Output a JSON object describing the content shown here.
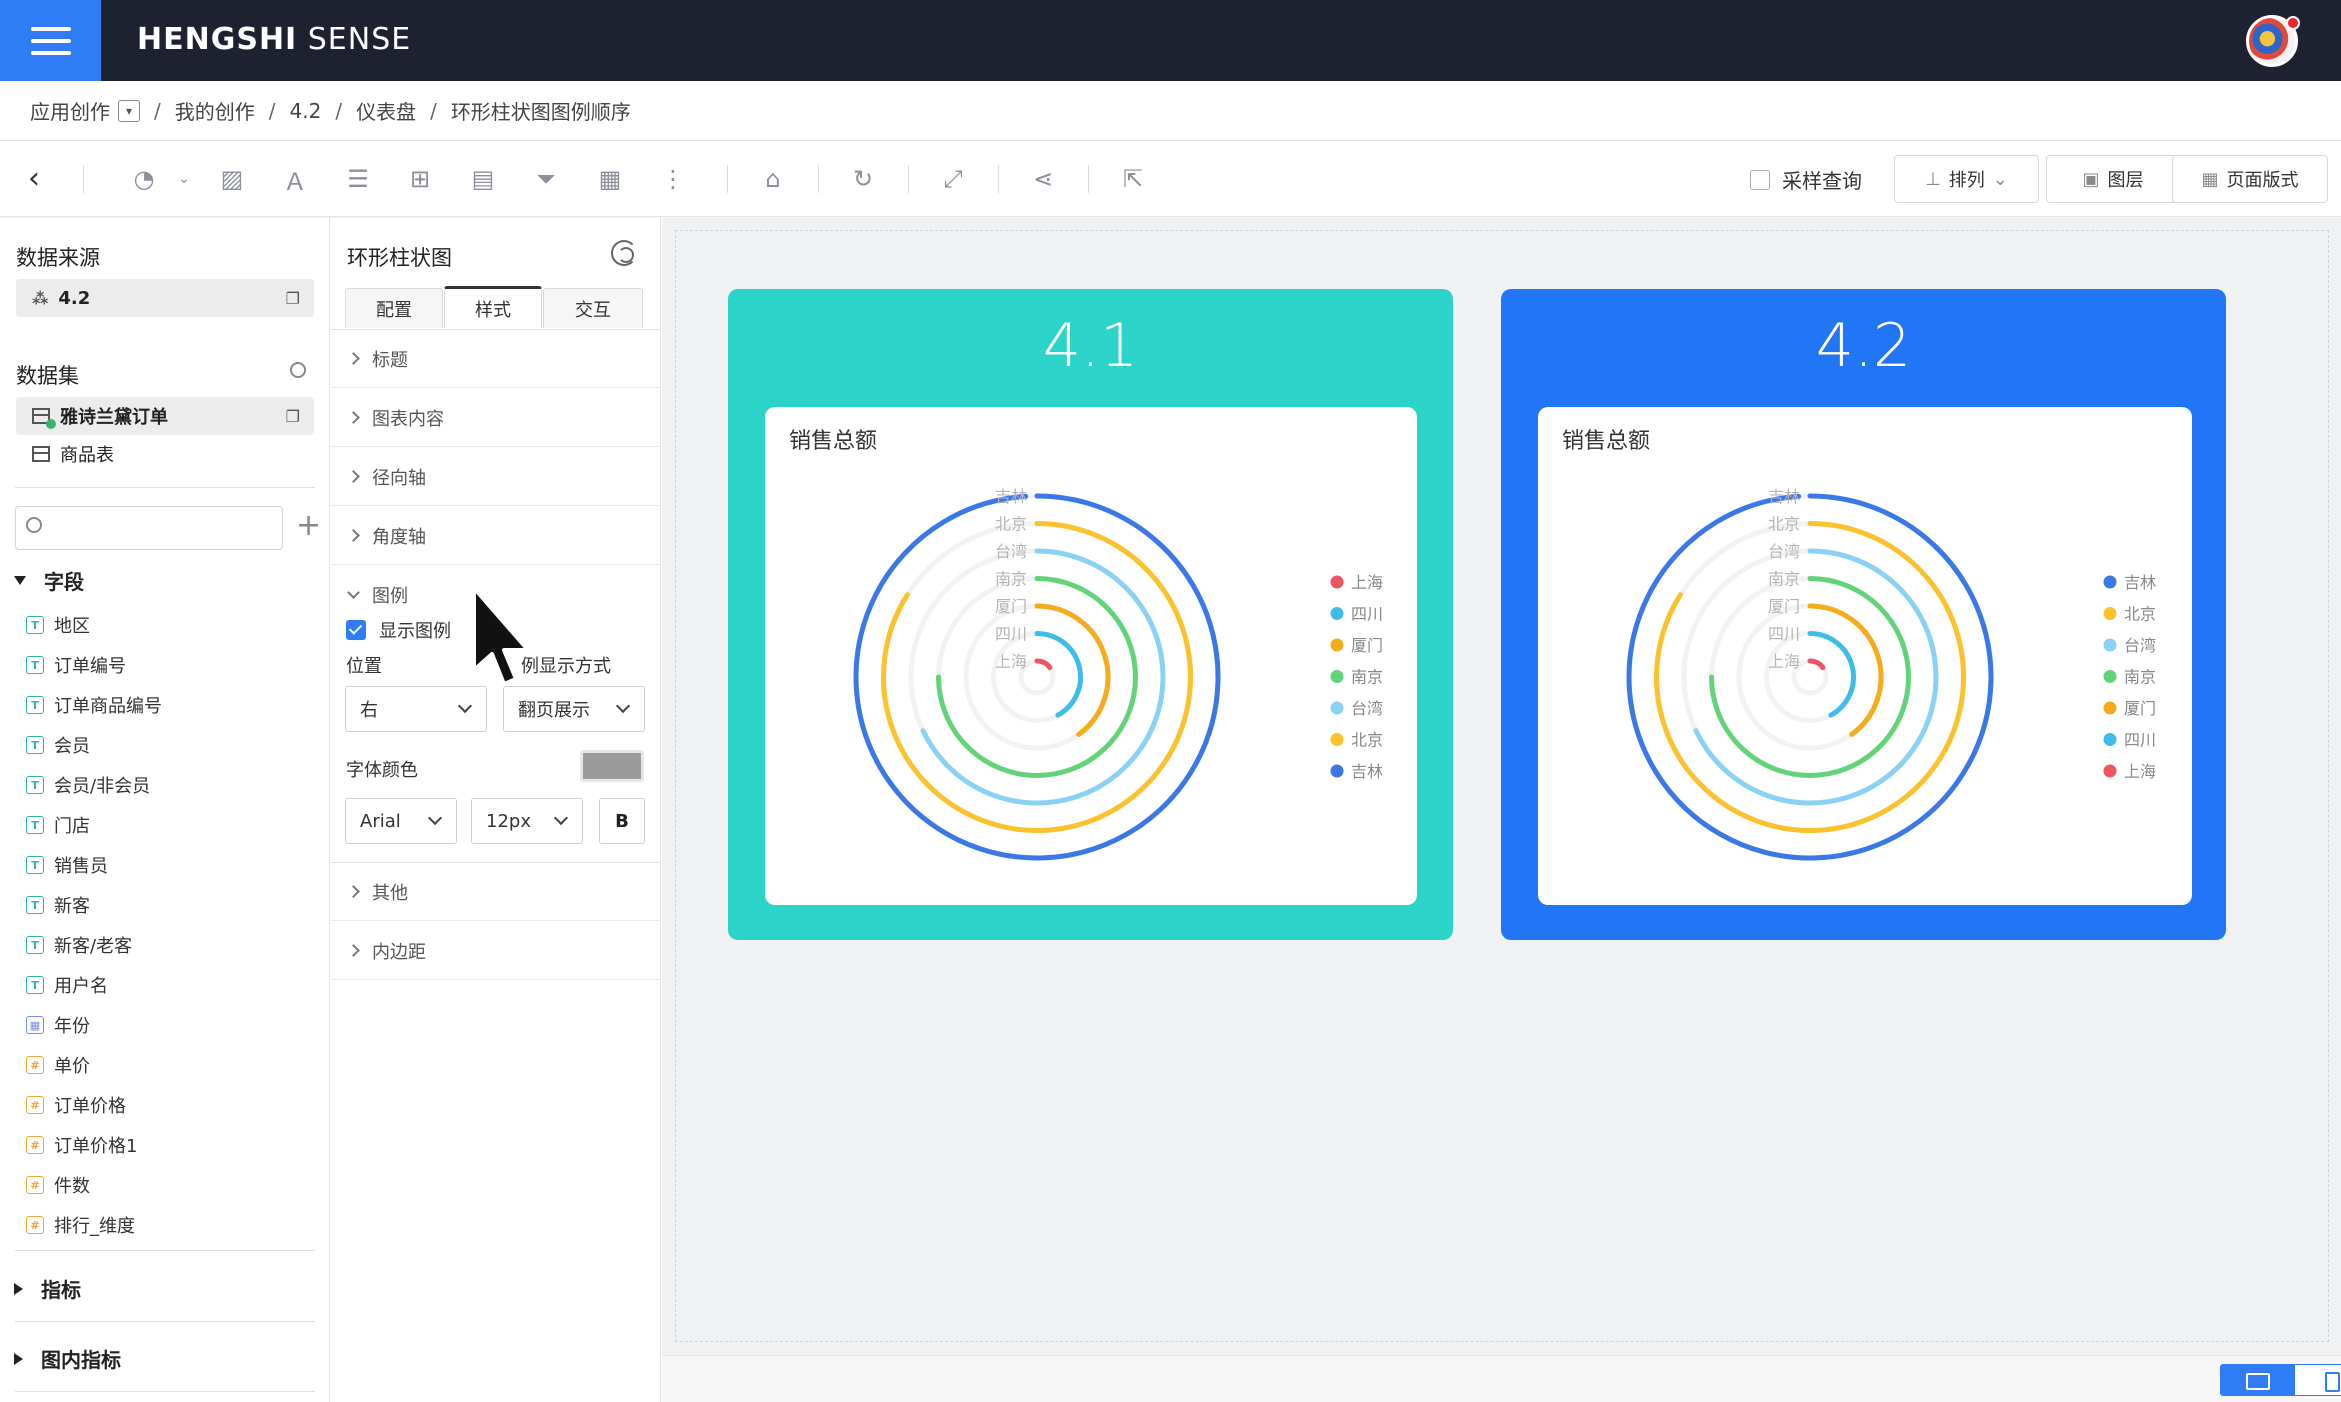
{
  "header": {
    "brand_bold": "HENGSHI",
    "brand_light": " SENSE"
  },
  "breadcrumb": [
    "应用创作",
    "我的创作",
    "4.2",
    "仪表盘",
    "环形柱状图图例顺序"
  ],
  "toolbar": {
    "sample_query_label": "采样查询",
    "arrange_label": "排列",
    "layers_label": "图层",
    "page_layout_label": "页面版式"
  },
  "left_panel": {
    "datasource_title": "数据来源",
    "datasource_item": "4.2",
    "dataset_title": "数据集",
    "datasets": [
      "雅诗兰黛订单",
      "商品表"
    ],
    "search_placeholder": "",
    "fields_title": "字段",
    "fields": [
      {
        "name": "地区",
        "type": "T"
      },
      {
        "name": "订单编号",
        "type": "T"
      },
      {
        "name": "订单商品编号",
        "type": "T"
      },
      {
        "name": "会员",
        "type": "T"
      },
      {
        "name": "会员/非会员",
        "type": "T"
      },
      {
        "name": "门店",
        "type": "T"
      },
      {
        "name": "销售员",
        "type": "T"
      },
      {
        "name": "新客",
        "type": "T"
      },
      {
        "name": "新客/老客",
        "type": "T"
      },
      {
        "name": "用户名",
        "type": "T"
      },
      {
        "name": "年份",
        "type": "date"
      },
      {
        "name": "单价",
        "type": "#"
      },
      {
        "name": "订单价格",
        "type": "#"
      },
      {
        "name": "订单价格1",
        "type": "#"
      },
      {
        "name": "件数",
        "type": "#"
      },
      {
        "name": "排行_维度",
        "type": "#"
      }
    ],
    "metrics_title": "指标",
    "inner_metrics_title": "图内指标"
  },
  "mid_panel": {
    "title": "环形柱状图",
    "tabs": [
      "配置",
      "样式",
      "交互"
    ],
    "active_tab": "样式",
    "sections": [
      "标题",
      "图表内容",
      "径向轴",
      "角度轴"
    ],
    "legend_section": "图例",
    "show_legend_label": "显示图例",
    "show_legend_checked": true,
    "position_label": "位置",
    "display_mode_label": "例显示方式",
    "position_value": "右",
    "display_mode_value": "翻页展示",
    "font_color_label": "字体颜色",
    "font_color": "#9b9b9b",
    "font_family_value": "Arial",
    "font_size_value": "12px",
    "bold_label": "B",
    "bottom_sections": [
      "其他",
      "内边距"
    ]
  },
  "chart_data": [
    {
      "type": "radial-bar",
      "card_title": "4.1",
      "card_color": "#2cd3c9",
      "title": "销售总额",
      "categories": [
        "吉林",
        "北京",
        "台湾",
        "南京",
        "厦门",
        "四川",
        "上海"
      ],
      "values": [
        0.99,
        0.84,
        0.68,
        0.75,
        0.4,
        0.42,
        0.15
      ],
      "colors": [
        "#3b78e7",
        "#fbc22e",
        "#89d1f5",
        "#63d37a",
        "#f5ab1b",
        "#3dbdeb",
        "#ee5563"
      ],
      "legend": [
        "上海",
        "四川",
        "厦门",
        "南京",
        "台湾",
        "北京",
        "吉林"
      ],
      "legend_colors": [
        "#ee5563",
        "#3dbdeb",
        "#f5ab1b",
        "#63d37a",
        "#89d1f5",
        "#fbc22e",
        "#3b78e7"
      ],
      "legend_position": "right"
    },
    {
      "type": "radial-bar",
      "card_title": "4.2",
      "card_color": "#2176f5",
      "title": "销售总额",
      "categories": [
        "吉林",
        "北京",
        "台湾",
        "南京",
        "厦门",
        "四川",
        "上海"
      ],
      "values": [
        0.99,
        0.84,
        0.68,
        0.75,
        0.4,
        0.42,
        0.15
      ],
      "colors": [
        "#3b78e7",
        "#fbc22e",
        "#89d1f5",
        "#63d37a",
        "#f5ab1b",
        "#3dbdeb",
        "#ee5563"
      ],
      "legend": [
        "吉林",
        "北京",
        "台湾",
        "南京",
        "厦门",
        "四川",
        "上海"
      ],
      "legend_colors": [
        "#3b78e7",
        "#fbc22e",
        "#89d1f5",
        "#63d37a",
        "#f5ab1b",
        "#3dbdeb",
        "#ee5563"
      ],
      "legend_position": "right"
    }
  ]
}
